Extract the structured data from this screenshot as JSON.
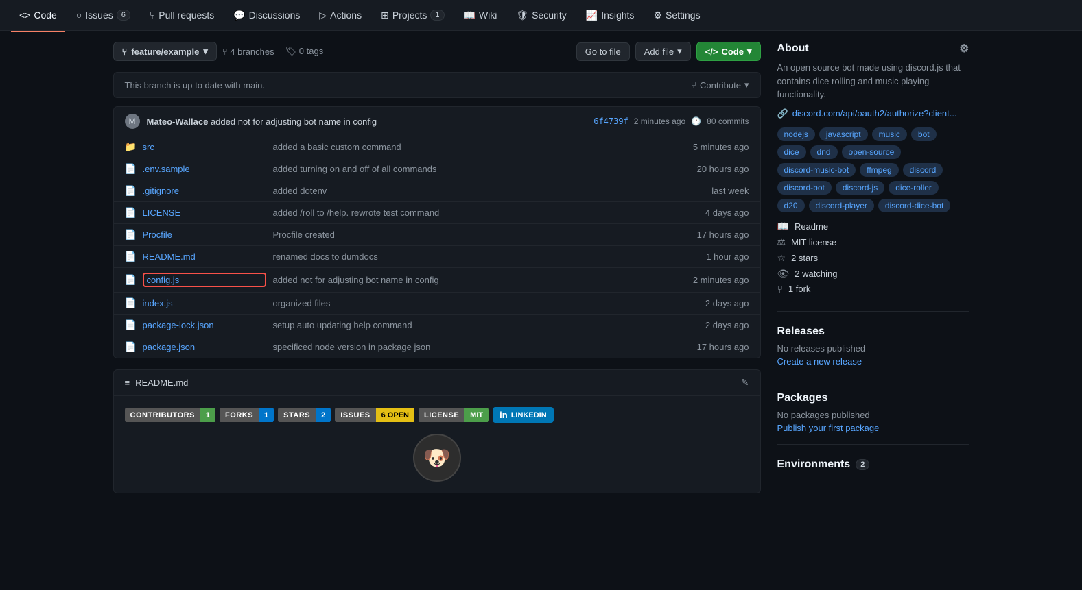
{
  "nav": {
    "items": [
      {
        "label": "Code",
        "icon": "<>",
        "active": true,
        "badge": null
      },
      {
        "label": "Issues",
        "icon": "○",
        "active": false,
        "badge": "6"
      },
      {
        "label": "Pull requests",
        "icon": "⑂",
        "active": false,
        "badge": null
      },
      {
        "label": "Discussions",
        "icon": "💬",
        "active": false,
        "badge": null
      },
      {
        "label": "Actions",
        "icon": "▷",
        "active": false,
        "badge": null
      },
      {
        "label": "Projects",
        "icon": "⊞",
        "active": false,
        "badge": "1"
      },
      {
        "label": "Wiki",
        "icon": "📖",
        "active": false,
        "badge": null
      },
      {
        "label": "Security",
        "icon": "🛡",
        "active": false,
        "badge": null
      },
      {
        "label": "Insights",
        "icon": "📈",
        "active": false,
        "badge": null
      },
      {
        "label": "Settings",
        "icon": "⚙",
        "active": false,
        "badge": null
      }
    ]
  },
  "branch": {
    "name": "feature/example",
    "branches_count": "4",
    "tags_count": "0"
  },
  "buttons": {
    "go_to_file": "Go to file",
    "add_file": "Add file",
    "code": "Code",
    "contribute": "Contribute"
  },
  "branch_status": "This branch is up to date with main.",
  "commit": {
    "author": "Mateo-Wallace",
    "message": "added not for adjusting bot name in config",
    "hash": "6f4739f",
    "time": "2 minutes ago",
    "count": "80 commits"
  },
  "files": [
    {
      "type": "dir",
      "name": "src",
      "commit_msg": "added a basic custom command",
      "time": "5 minutes ago",
      "highlighted": false
    },
    {
      "type": "file",
      "name": ".env.sample",
      "commit_msg": "added turning on and off of all commands",
      "time": "20 hours ago",
      "highlighted": false
    },
    {
      "type": "file",
      "name": ".gitignore",
      "commit_msg": "added dotenv",
      "time": "last week",
      "highlighted": false
    },
    {
      "type": "file",
      "name": "LICENSE",
      "commit_msg": "added /roll to /help. rewrote test command",
      "time": "4 days ago",
      "highlighted": false
    },
    {
      "type": "file",
      "name": "Procfile",
      "commit_msg": "Procfile created",
      "time": "17 hours ago",
      "highlighted": false
    },
    {
      "type": "file",
      "name": "README.md",
      "commit_msg": "renamed docs to dumdocs",
      "time": "1 hour ago",
      "highlighted": false
    },
    {
      "type": "file",
      "name": "config.js",
      "commit_msg": "added not for adjusting bot name in config",
      "time": "2 minutes ago",
      "highlighted": true
    },
    {
      "type": "file",
      "name": "index.js",
      "commit_msg": "organized files",
      "time": "2 days ago",
      "highlighted": false
    },
    {
      "type": "file",
      "name": "package-lock.json",
      "commit_msg": "setup auto updating help command",
      "time": "2 days ago",
      "highlighted": false
    },
    {
      "type": "file",
      "name": "package.json",
      "commit_msg": "specificed node version in package json",
      "time": "17 hours ago",
      "highlighted": false
    }
  ],
  "readme": {
    "title": "README.md",
    "badges": [
      {
        "label": "CONTRIBUTORS",
        "value": "1",
        "color": "green"
      },
      {
        "label": "FORKS",
        "value": "1",
        "color": "blue"
      },
      {
        "label": "STARS",
        "value": "2",
        "color": "blue"
      },
      {
        "label": "ISSUES",
        "value": "6 OPEN",
        "color": "yellow"
      },
      {
        "label": "LICENSE",
        "value": "MIT",
        "color": "mit"
      },
      {
        "label": "LINKEDIN",
        "type": "linkedin"
      }
    ]
  },
  "about": {
    "title": "About",
    "description": "An open source bot made using discord.js that contains dice rolling and music playing functionality.",
    "link": "discord.com/api/oauth2/authorize?client...",
    "tags": [
      "nodejs",
      "javascript",
      "music",
      "bot",
      "dice",
      "dnd",
      "open-source",
      "discord-music-bot",
      "ffmpeg",
      "discord",
      "discord-bot",
      "discord-js",
      "dice-roller",
      "d20",
      "discord-player",
      "discord-dice-bot"
    ],
    "readme_label": "Readme",
    "license_label": "MIT license",
    "stars": "2 stars",
    "watching": "2 watching",
    "forks": "1 fork"
  },
  "releases": {
    "title": "Releases",
    "empty": "No releases published",
    "create_link": "Create a new release"
  },
  "packages": {
    "title": "Packages",
    "empty": "No packages published",
    "create_link": "Publish your first package"
  },
  "environments": {
    "title": "Environments",
    "count": "2"
  }
}
